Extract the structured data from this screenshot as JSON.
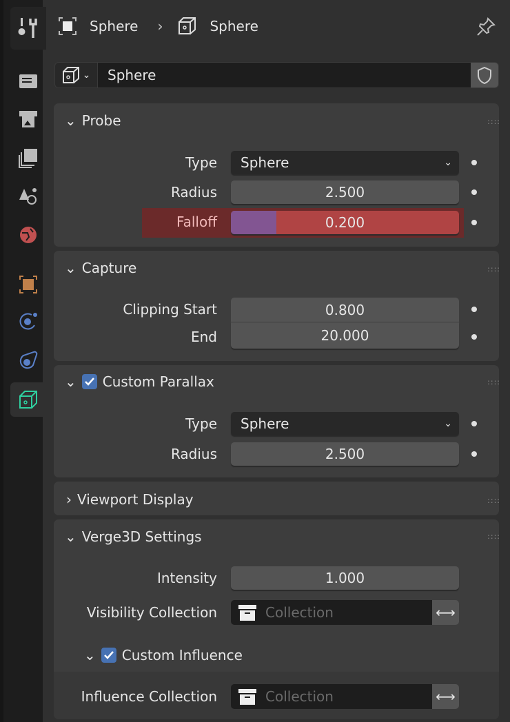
{
  "breadcrumb": {
    "object": "Sphere",
    "data": "Sphere"
  },
  "datablock": {
    "name": "Sphere"
  },
  "sidebar": {
    "tabs": [
      "tool",
      "render",
      "output",
      "view-layer",
      "scene",
      "world",
      "object",
      "physics",
      "constraints",
      "data"
    ],
    "active": "data"
  },
  "panels": {
    "probe": {
      "title": "Probe",
      "type_label": "Type",
      "type_value": "Sphere",
      "radius_label": "Radius",
      "radius_value": "2.500",
      "falloff_label": "Falloff",
      "falloff_value": "0.200",
      "falloff_fraction": 0.2
    },
    "capture": {
      "title": "Capture",
      "clip_start_label": "Clipping Start",
      "clip_start_value": "0.800",
      "end_label": "End",
      "end_value": "20.000"
    },
    "parallax": {
      "title": "Custom Parallax",
      "checked": true,
      "type_label": "Type",
      "type_value": "Sphere",
      "radius_label": "Radius",
      "radius_value": "2.500"
    },
    "viewport": {
      "title": "Viewport Display",
      "expanded": false
    },
    "verge": {
      "title": "Verge3D Settings",
      "intensity_label": "Intensity",
      "intensity_value": "1.000",
      "vis_label": "Visibility Collection",
      "vis_placeholder": "Collection",
      "influence_title": "Custom Influence",
      "influence_checked": true,
      "inf_label": "Influence Collection",
      "inf_placeholder": "Collection"
    }
  },
  "colors": {
    "accent": "#4772b3",
    "animated": "#b04444",
    "active_tab_icon": "#2fd0a0"
  }
}
